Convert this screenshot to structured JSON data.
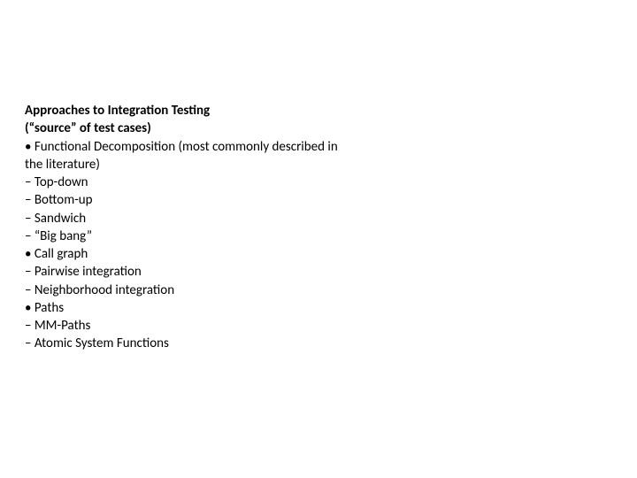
{
  "slide": {
    "title": "Approaches to Integration Testing",
    "subtitle": "(“source” of test cases)",
    "lines": [
      "• Functional Decomposition (most commonly described in",
      "the literature)",
      "– Top-down",
      "– Bottom-up",
      "– Sandwich",
      "– “Big bang”",
      "• Call graph",
      "– Pairwise integration",
      "– Neighborhood integration",
      "• Paths",
      "– MM-Paths",
      "– Atomic System Functions"
    ]
  }
}
